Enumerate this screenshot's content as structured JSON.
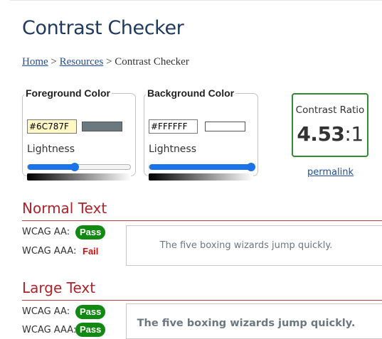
{
  "page": {
    "title": "Contrast Checker"
  },
  "breadcrumb": {
    "home": "Home",
    "sep1": " > ",
    "resources": "Resources",
    "sep2": " > ",
    "current": "Contrast Checker"
  },
  "foreground": {
    "legend": "Foreground Color",
    "hex": "#6C787F",
    "color": "#6C787F",
    "lightness_label": "Lightness",
    "lightness": 0.46
  },
  "background": {
    "legend": "Background Color",
    "hex": "#FFFFFF",
    "color": "#FFFFFF",
    "lightness_label": "Lightness",
    "lightness": 1.0
  },
  "ratio": {
    "label": "Contrast Ratio",
    "value": "4.53",
    "suffix": ":1",
    "permalink": "permalink"
  },
  "normal_text": {
    "heading": "Normal Text",
    "aa_label": "WCAG AA:",
    "aa_result": "Pass",
    "aaa_label": "WCAG AAA:",
    "aaa_result": "Fail",
    "sample": "The five boxing wizards jump quickly."
  },
  "large_text": {
    "heading": "Large Text",
    "aa_label": "WCAG AA:",
    "aa_result": "Pass",
    "aaa_label": "WCAG AAA:",
    "aaa_result": "Pass",
    "sample": "The five boxing wizards jump quickly."
  },
  "colors": {
    "accent": "#1a73e8",
    "pass": "#128a12",
    "fail": "#cc1111",
    "heading": "#b2222b",
    "title": "#1f3a60"
  }
}
